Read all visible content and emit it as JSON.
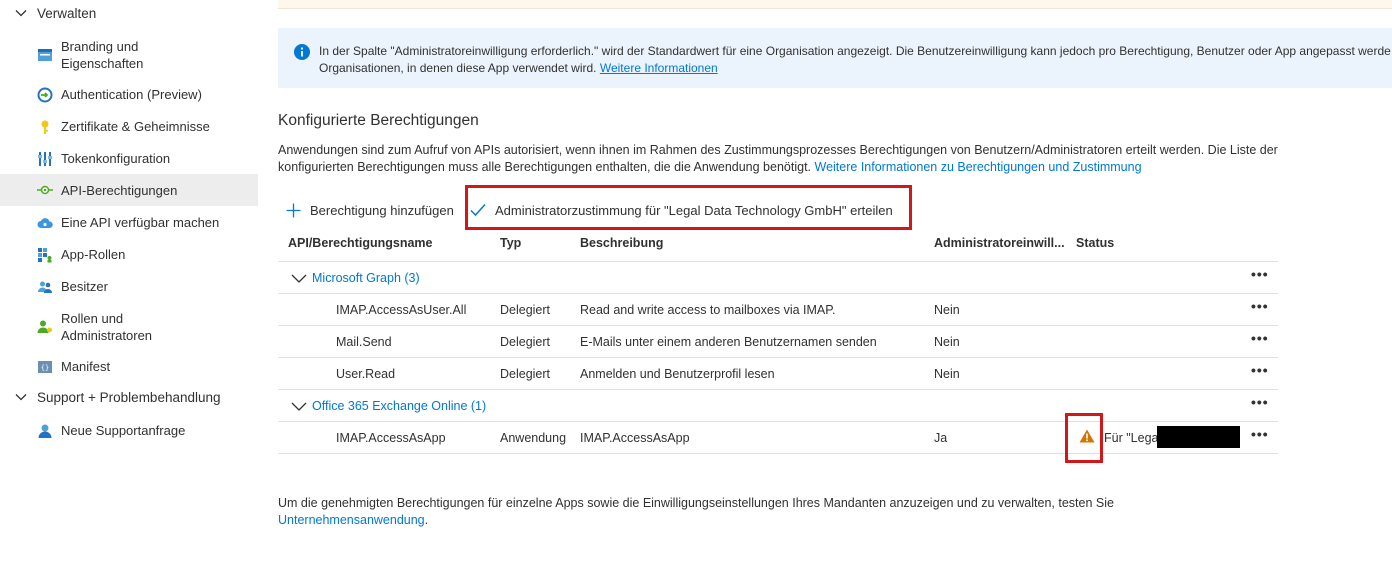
{
  "sidebar": {
    "section_verwalten": "Verwalten",
    "items": [
      {
        "label": "Branding und Eigenschaften",
        "icon": "branding-icon"
      },
      {
        "label": "Authentication (Preview)",
        "icon": "authentication-icon"
      },
      {
        "label": "Zertifikate & Geheimnisse",
        "icon": "key-icon"
      },
      {
        "label": "Tokenkonfiguration",
        "icon": "token-config-icon"
      },
      {
        "label": "API-Berechtigungen",
        "icon": "api-permissions-icon",
        "active": true
      },
      {
        "label": "Eine API verfügbar machen",
        "icon": "cloud-icon"
      },
      {
        "label": "App-Rollen",
        "icon": "app-roles-icon"
      },
      {
        "label": "Besitzer",
        "icon": "owners-icon"
      },
      {
        "label": "Rollen und Administratoren",
        "icon": "roles-admins-icon"
      },
      {
        "label": "Manifest",
        "icon": "manifest-icon"
      }
    ],
    "section_support": "Support + Problembehandlung",
    "support_items": [
      {
        "label": "Neue Supportanfrage",
        "icon": "support-request-icon"
      }
    ]
  },
  "info_banner": {
    "text": "In der Spalte \"Administratoreinwilligung erforderlich.\" wird der Standardwert für eine Organisation angezeigt. Die Benutzereinwilligung kann jedoch pro Berechtigung, Benutzer oder App angepasst werde",
    "text_line2": "Organisationen, in denen diese App verwendet wird.",
    "link": "Weitere Informationen"
  },
  "section": {
    "title": "Konfigurierte Berechtigungen",
    "description": "Anwendungen sind zum Aufruf von APIs autorisiert, wenn ihnen im Rahmen des Zustimmungsprozesses Berechtigungen von Benutzern/Administratoren erteilt werden. Die Liste der konfigurierten Berechtigungen muss alle Berechtigungen enthalten, die die Anwendung benötigt.",
    "description_link": "Weitere Informationen zu Berechtigungen und Zustimmung"
  },
  "toolbar": {
    "add_label": "Berechtigung hinzufügen",
    "grant_label": "Administratorzustimmung für \"Legal Data Technology GmbH\" erteilen"
  },
  "table": {
    "headers": [
      "API/Berechtigungsname",
      "Typ",
      "Beschreibung",
      "Administratoreinwill...",
      "Status"
    ],
    "groups": [
      {
        "name": "Microsoft Graph (3)",
        "rows": [
          {
            "name": "IMAP.AccessAsUser.All",
            "type": "Delegiert",
            "description": "Read and write access to mailboxes via IMAP.",
            "admin": "Nein",
            "status": ""
          },
          {
            "name": "Mail.Send",
            "type": "Delegiert",
            "description": "E-Mails unter einem anderen Benutzernamen senden",
            "admin": "Nein",
            "status": ""
          },
          {
            "name": "User.Read",
            "type": "Delegiert",
            "description": "Anmelden und Benutzerprofil lesen",
            "admin": "Nein",
            "status": ""
          }
        ]
      },
      {
        "name": "Office 365 Exchange Online (1)",
        "rows": [
          {
            "name": "IMAP.AccessAsApp",
            "type": "Anwendung",
            "description": "IMAP.AccessAsApp",
            "admin": "Ja",
            "status": "Für \"Legal"
          }
        ]
      }
    ],
    "more_label": "•••"
  },
  "footer": {
    "text": "Um die genehmigten Berechtigungen für einzelne Apps sowie die Einwilligungseinstellungen Ihres Mandanten anzuzeigen und zu verwalten, testen Sie",
    "link": "Unternehmensanwendung",
    "tail": "."
  },
  "colors": {
    "accent": "#0078d4",
    "highlight": "#d01818",
    "warning": "#d47500",
    "info_bg": "#ebf3fc"
  }
}
